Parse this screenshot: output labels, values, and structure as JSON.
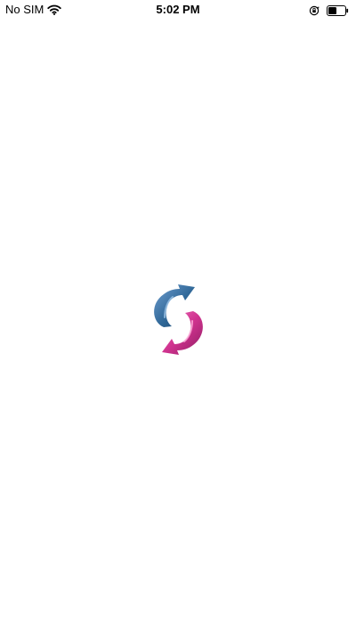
{
  "status_bar": {
    "carrier": "No SIM",
    "time": "5:02 PM",
    "battery_level": 0.5,
    "icons": {
      "wifi": "wifi-icon",
      "orientation_lock": "orientation-lock-icon",
      "battery": "battery-icon"
    }
  },
  "splash": {
    "logo_icon": "refresh-arrows-icon",
    "colors": {
      "blue_arrow": "#2f6797",
      "magenta_arrow": "#d0338f"
    }
  }
}
